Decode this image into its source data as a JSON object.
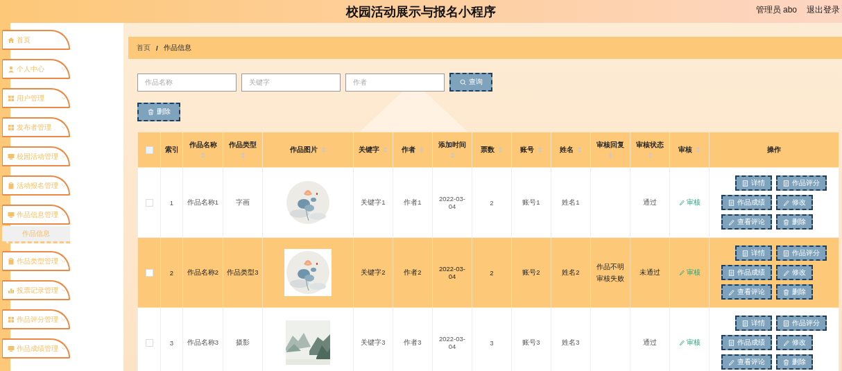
{
  "header": {
    "title": "校园活动展示与报名小程序",
    "user": "管理员 abo",
    "logout": "退出登录"
  },
  "sidebar": {
    "items": [
      {
        "label": "首页"
      },
      {
        "label": "个人中心"
      },
      {
        "label": "用户管理"
      },
      {
        "label": "发布者管理"
      },
      {
        "label": "校园活动管理"
      },
      {
        "label": "活动报名管理"
      },
      {
        "label": "作品信息管理",
        "children": [
          {
            "label": "作品信息",
            "selected": true
          }
        ]
      },
      {
        "label": "作品类型管理"
      },
      {
        "label": "投票记录管理"
      },
      {
        "label": "作品评分管理"
      },
      {
        "label": "作品成绩管理"
      }
    ]
  },
  "breadcrumb": {
    "items": [
      "首页",
      "作品信息"
    ],
    "separator": "/"
  },
  "search": {
    "fields": [
      {
        "placeholder": "作品名称"
      },
      {
        "placeholder": "关键字"
      },
      {
        "placeholder": "作者"
      }
    ],
    "button": "查询"
  },
  "delete_button": "删除",
  "table": {
    "select_all": {
      "checked": false
    },
    "columns": [
      {
        "label": "索引",
        "sortable": false
      },
      {
        "label": "作品名称",
        "sortable": true
      },
      {
        "label": "作品类型",
        "sortable": true
      },
      {
        "label": "作品图片",
        "sortable": true
      },
      {
        "label": "关键字",
        "sortable": true
      },
      {
        "label": "作者",
        "sortable": true
      },
      {
        "label": "添加时间",
        "sortable": true
      },
      {
        "label": "票数",
        "sortable": true
      },
      {
        "label": "账号",
        "sortable": true
      },
      {
        "label": "姓名",
        "sortable": true
      },
      {
        "label": "审核回复",
        "sortable": true
      },
      {
        "label": "审核状态",
        "sortable": true
      },
      {
        "label": "审核",
        "sortable": true
      },
      {
        "label": "操作",
        "sortable": false
      }
    ],
    "rows": [
      {
        "selected": false,
        "checked": false,
        "index": "1",
        "name": "作品名称1",
        "type": "字画",
        "keyword": "关键字1",
        "author": "作者1",
        "time": "2022-03-04",
        "votes": "2",
        "account": "账号1",
        "person": "姓名1",
        "status": "通过",
        "audit": "审核",
        "actions": [
          {
            "label": "详情",
            "kind": "doc"
          },
          {
            "label": "作品评分",
            "kind": "doc"
          },
          {
            "label": "作品成绩",
            "kind": "doc"
          },
          {
            "label": "修改",
            "kind": "edit"
          },
          {
            "label": "查看评论",
            "kind": "edit"
          },
          {
            "label": "删除",
            "kind": "delete"
          }
        ]
      },
      {
        "selected": true,
        "checked": false,
        "index": "2",
        "name": "作品名称2",
        "type": "作品类型3",
        "keyword": "关键字2",
        "author": "作者2",
        "time": "2022-03-04",
        "votes": "2",
        "account": "账号2",
        "person": "姓名2",
        "reply": "作品不明审核失败",
        "status": "未通过",
        "audit": "审核",
        "actions": [
          {
            "label": "详情",
            "kind": "doc"
          },
          {
            "label": "作品评分",
            "kind": "doc"
          },
          {
            "label": "作品成绩",
            "kind": "doc"
          },
          {
            "label": "修改",
            "kind": "edit"
          },
          {
            "label": "查看评论",
            "kind": "edit"
          },
          {
            "label": "删除",
            "kind": "delete"
          }
        ]
      },
      {
        "selected": false,
        "checked": false,
        "index": "3",
        "name": "作品名称3",
        "type": "摄影",
        "keyword": "关键字3",
        "author": "作者3",
        "time": "2022-03-04",
        "votes": "3",
        "account": "账号3",
        "person": "姓名3",
        "status": "通过",
        "audit": "审核",
        "actions": [
          {
            "label": "详情",
            "kind": "doc"
          },
          {
            "label": "作品评分",
            "kind": "doc"
          },
          {
            "label": "作品成绩",
            "kind": "doc"
          },
          {
            "label": "修改",
            "kind": "edit"
          },
          {
            "label": "查看评论",
            "kind": "edit"
          },
          {
            "label": "删除",
            "kind": "delete"
          }
        ]
      }
    ]
  }
}
